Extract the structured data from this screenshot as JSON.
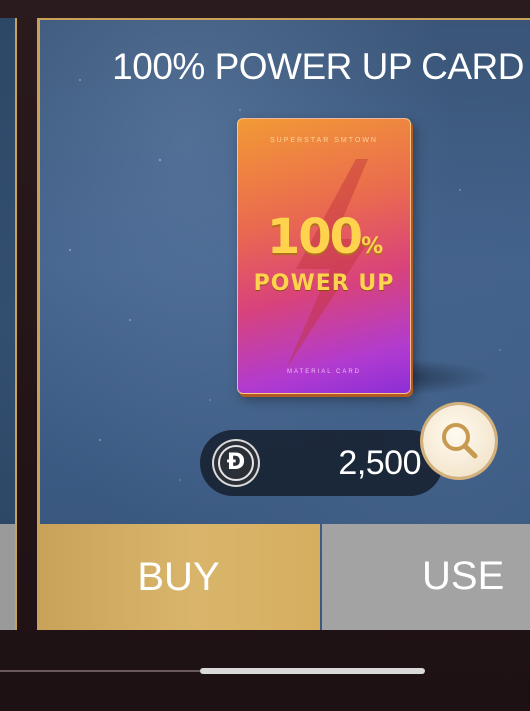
{
  "shop_item": {
    "title": "100% POWER UP CARD",
    "card_art": {
      "top_text": "SUPERSTAR SMTOWN",
      "big_value": "100",
      "big_unit": "%",
      "subtitle": "POWER UP",
      "bottom_text": "MATERIAL CARD"
    },
    "price": {
      "currency_icon": "d-coin-icon",
      "amount": "2,500"
    },
    "zoom_icon": "magnifier-icon"
  },
  "actions": {
    "buy_label": "BUY",
    "use_label": "USE"
  },
  "colors": {
    "accent_gold": "#c9a25a",
    "panel_blue": "#3a5577",
    "use_gray": "#a3a3a3"
  }
}
